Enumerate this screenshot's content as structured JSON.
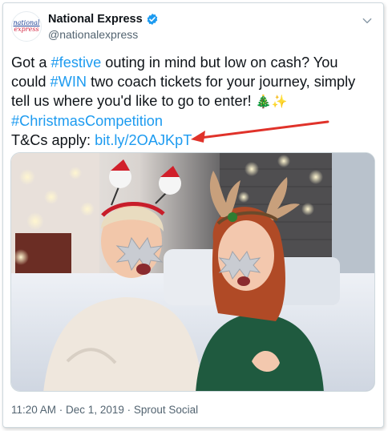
{
  "account": {
    "display_name": "National Express",
    "handle": "@nationalexpress",
    "logo_line1": "national",
    "logo_line2": "express",
    "verified": true
  },
  "tweet": {
    "line1_pre": "Got a ",
    "line1_tag": "#festive",
    "line1_post": " outing in mind but low on cash? You",
    "line2_pre": "could ",
    "line2_tag": "#WIN",
    "line2_post": " two coach tickets for your journey, simply",
    "line3_text": "tell us where you'd like to go to enter! ",
    "line3_emoji": "🎄✨",
    "line4_tag": "#ChristmasCompetition",
    "line5_pre": "T&Cs apply: ",
    "line5_link": "bit.ly/2OAJKpT"
  },
  "media": {
    "icon": "photo-two-women-christmas"
  },
  "footer": {
    "time": "11:20 AM",
    "separator1": " · ",
    "date": "Dec 1, 2019",
    "separator2": " · ",
    "source": "Sprout Social"
  },
  "colors": {
    "link": "#1d9bf0",
    "arrow": "#e0322a",
    "verified": "#1d9bf0"
  }
}
